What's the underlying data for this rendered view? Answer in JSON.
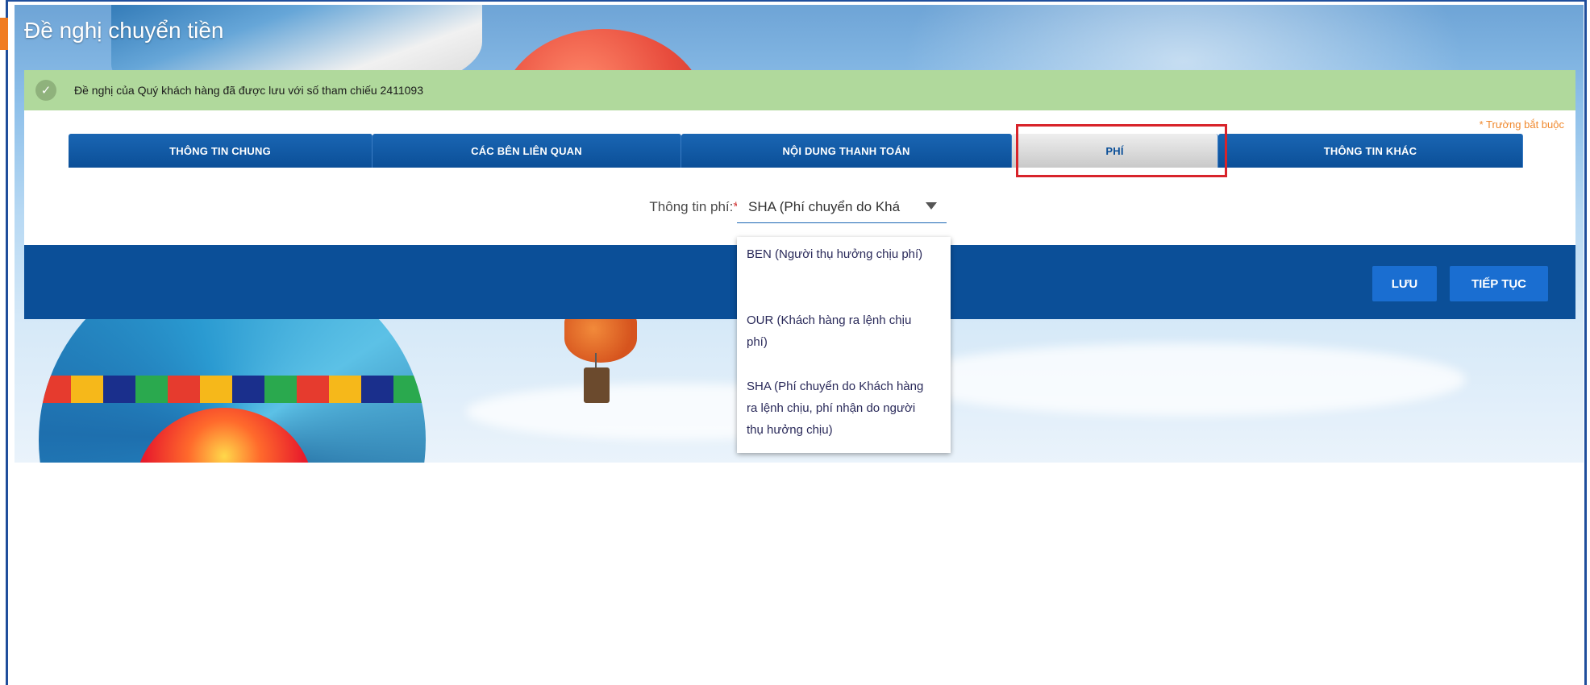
{
  "page": {
    "title": "Đề nghị chuyển tiền"
  },
  "notice": {
    "text": "Đề nghị của Quý khách hàng đã được lưu với số tham chiếu 2411093"
  },
  "form": {
    "required_note": "* Trường bắt buộc",
    "tabs": [
      {
        "label": "THÔNG TIN CHUNG",
        "active": false
      },
      {
        "label": "CÁC BÊN LIÊN QUAN",
        "active": false
      },
      {
        "label": "NỘI DUNG THANH TOÁN",
        "active": false
      },
      {
        "label": "PHÍ",
        "active": true
      },
      {
        "label": "THÔNG TIN KHÁC",
        "active": false
      }
    ],
    "fee": {
      "label": "Thông tin phí:",
      "required_mark": "*",
      "selected_value": "SHA (Phí chuyển do Khá"
    }
  },
  "dropdown": {
    "options": [
      "BEN (Người thụ hưởng chịu phí)",
      "OUR (Khách hàng ra lệnh chịu phí)",
      "SHA (Phí chuyển do Khách hàng ra lệnh chịu, phí nhận do người thụ hưởng chịu)"
    ]
  },
  "actions": {
    "save_label": "LƯU",
    "next_label": "TIẾP TỤC"
  },
  "colors": {
    "primary_blue": "#0b4f98",
    "button_blue": "#1a6ed1",
    "notice_green": "#b0d99c",
    "highlight_red": "#d8232a",
    "required_orange": "#f0882c"
  }
}
